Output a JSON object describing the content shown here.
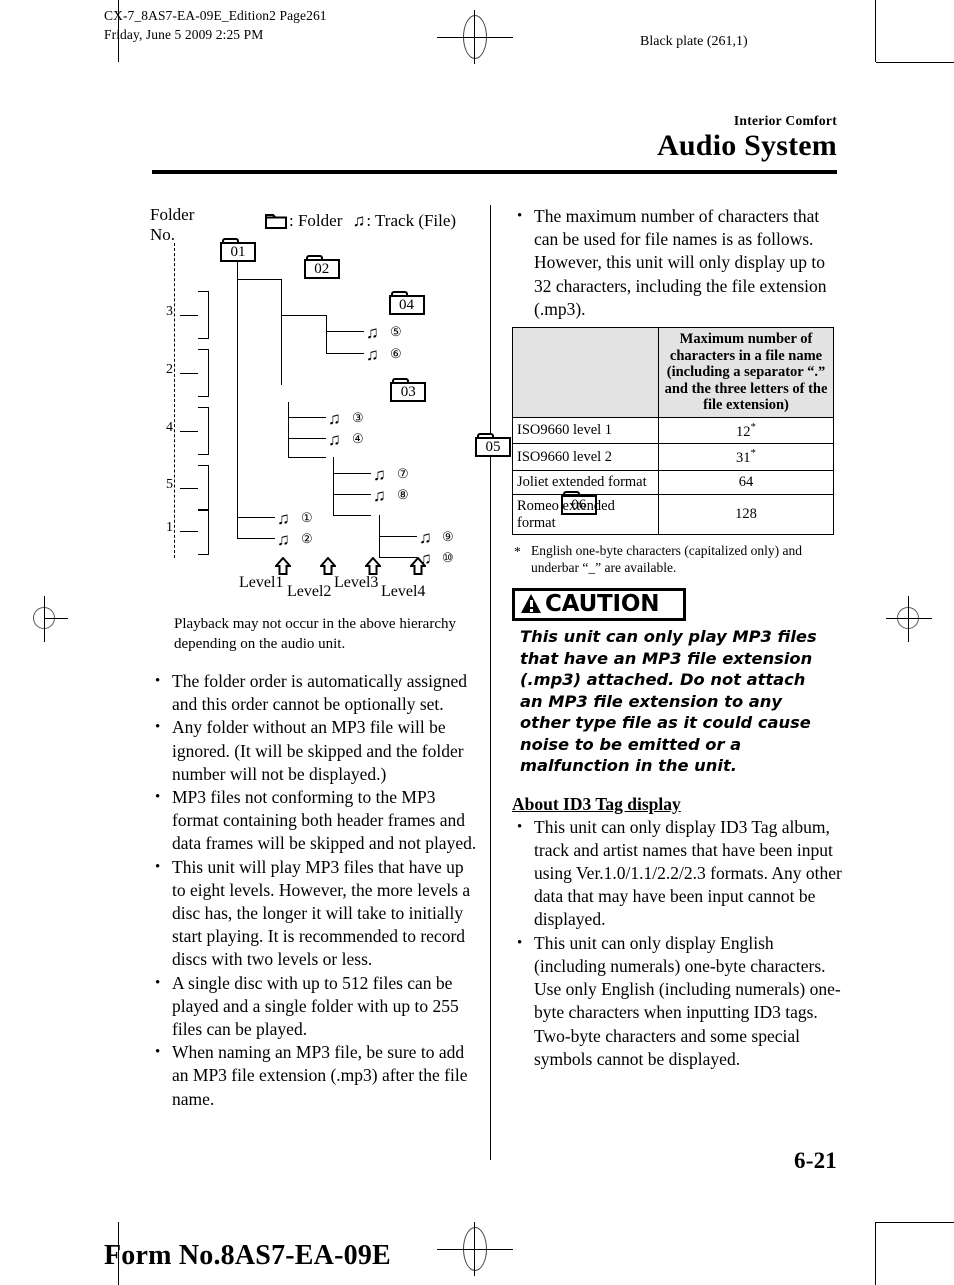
{
  "print_marks": {
    "file_info_line1": "CX-7_8AS7-EA-09E_Edition2 Page261",
    "file_info_line2": "Friday, June 5 2009 2:25 PM",
    "black_plate": "Black plate (261,1)",
    "form_number": "Form No.8AS7-EA-09E"
  },
  "header": {
    "section": "Interior Comfort",
    "title": "Audio System"
  },
  "diagram": {
    "folder_no_label_line1": "Folder",
    "folder_no_label_line2": "No.",
    "legend_folder": ": Folder",
    "legend_track": ": Track (File)",
    "folders": [
      "01",
      "02",
      "04",
      "03",
      "05",
      "06"
    ],
    "folder_numbers": [
      "3",
      "2",
      "4",
      "5",
      "1"
    ],
    "tracks": [
      "⑤",
      "⑥",
      "③",
      "④",
      "⑦",
      "⑧",
      "⑨",
      "⑩",
      "①",
      "②"
    ],
    "levels": [
      "Level1",
      "Level2",
      "Level3",
      "Level4"
    ],
    "caption": "Playback may not occur in the above hierarchy depending on the audio unit."
  },
  "left_column": {
    "bullets": [
      "The folder order is automatically assigned and this order cannot be optionally set.",
      "Any folder without an MP3 file will be ignored. (It will be skipped and the folder number will not be displayed.)",
      "MP3 files not conforming to the MP3 format containing both header frames and data frames will be skipped and not played.",
      "This unit will play MP3 files that have up to eight levels. However, the more levels a disc has, the longer it will take to initially start playing. It is recommended to record discs with two levels or less.",
      "A single disc with up to 512 files can be played and a single folder with up to 255 files can be played.",
      "When naming an MP3 file, be sure to add an MP3 file extension (.mp3) after the file name."
    ]
  },
  "right_column": {
    "intro_bullet": "The maximum number of characters that can be used for file names is as follows. However, this unit will only display up to 32 characters, including the file extension (.mp3).",
    "table": {
      "header_blank": "",
      "header_value": "Maximum number of characters in a file name (including a separator “.” and the three letters of the file extension)",
      "rows": [
        {
          "label": "ISO9660 level 1",
          "value": "12",
          "star": "*"
        },
        {
          "label": "ISO9660 level 2",
          "value": "31",
          "star": "*"
        },
        {
          "label": "Joliet extended format",
          "value": "64",
          "star": ""
        },
        {
          "label": "Romeo extended format",
          "value": "128",
          "star": ""
        }
      ]
    },
    "footnote_marker": "*",
    "footnote": "English one-byte characters (capitalized only) and underbar “_” are available.",
    "caution": {
      "label": "CAUTION",
      "icon": "warning-triangle-icon",
      "text": "This unit can only play MP3 files that have an MP3 file extension (.mp3) attached. Do not attach an MP3 file extension to any other type file as it could cause noise to be emitted or a malfunction in the unit."
    },
    "id3_heading": "About ID3 Tag display",
    "id3_bullets": [
      "This unit can only display ID3 Tag album, track and artist names that have been input using Ver.1.0/1.1/2.2/2.3 formats. Any other data that may have been input cannot be displayed.",
      "This unit can only display English (including numerals) one-byte characters. Use only English (including numerals) one-byte characters when inputting ID3 tags. Two-byte characters and some special symbols cannot be displayed."
    ]
  },
  "footer": {
    "page_number": "6-21"
  }
}
